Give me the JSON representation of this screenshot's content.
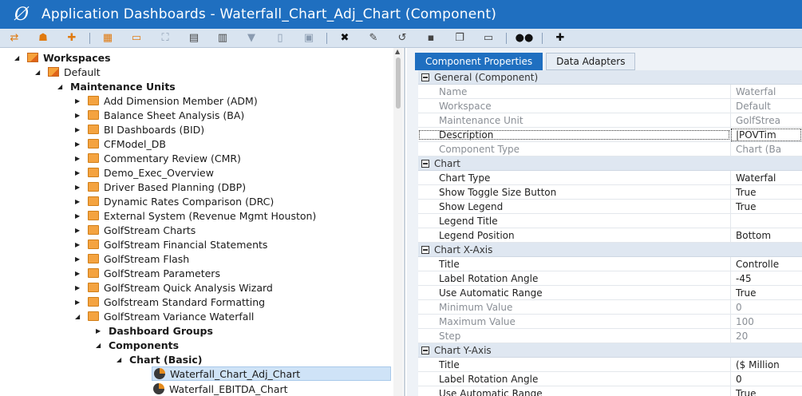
{
  "window": {
    "title": "Application Dashboards - Waterfall_Chart_Adj_Chart (Component)",
    "logo_icon": "onestream-logo"
  },
  "toolbar": {
    "icons": [
      "swap-icon",
      "group-icon",
      "add-user-icon",
      "dashboard-icon",
      "calendar-icon",
      "chart-icon",
      "table-icon",
      "grid-icon",
      "filter-icon",
      "document-icon",
      "textbox-icon",
      "delete-icon",
      "edit-icon",
      "undo-icon",
      "save-icon",
      "copy-icon",
      "paste-icon",
      "search-binoculars-icon",
      "add-icon"
    ]
  },
  "tree": {
    "items": [
      {
        "label": "Workspaces",
        "bold": true
      },
      {
        "label": "Default",
        "bold": false
      },
      {
        "label": "Maintenance Units",
        "bold": true
      },
      {
        "label": "Add Dimension Member (ADM)"
      },
      {
        "label": "Balance Sheet Analysis (BA)"
      },
      {
        "label": "BI Dashboards (BID)"
      },
      {
        "label": "CFModel_DB"
      },
      {
        "label": "Commentary Review (CMR)"
      },
      {
        "label": "Demo_Exec_Overview"
      },
      {
        "label": "Driver Based Planning (DBP)"
      },
      {
        "label": "Dynamic Rates Comparison (DRC)"
      },
      {
        "label": "External System (Revenue Mgmt Houston)"
      },
      {
        "label": "GolfStream Charts"
      },
      {
        "label": "GolfStream Financial Statements"
      },
      {
        "label": "GolfStream Flash"
      },
      {
        "label": "GolfStream Parameters"
      },
      {
        "label": "GolfStream Quick Analysis Wizard"
      },
      {
        "label": "Golfstream Standard Formatting"
      },
      {
        "label": "GolfStream Variance Waterfall"
      },
      {
        "label": "Dashboard Groups",
        "bold": true
      },
      {
        "label": "Components",
        "bold": true
      },
      {
        "label": "Chart (Basic)",
        "bold": true
      },
      {
        "label": "Waterfall_Chart_Adj_Chart"
      },
      {
        "label": "Waterfall_EBITDA_Chart"
      }
    ]
  },
  "tabs": [
    {
      "label": "Component Properties",
      "active": true
    },
    {
      "label": "Data Adapters",
      "active": false
    }
  ],
  "properties": {
    "general": {
      "header": "General (Component)",
      "rows": [
        {
          "key": "Name",
          "value": "Waterfal"
        },
        {
          "key": "Workspace",
          "value": "Default"
        },
        {
          "key": "Maintenance Unit",
          "value": "GolfStrea"
        },
        {
          "key": "Description",
          "value": "|POVTim"
        },
        {
          "key": "Component Type",
          "value": "Chart (Ba"
        }
      ]
    },
    "chart": {
      "header": "Chart",
      "rows": [
        {
          "key": "Chart Type",
          "value": "Waterfal"
        },
        {
          "key": "Show Toggle Size Button",
          "value": "True"
        },
        {
          "key": "Show Legend",
          "value": "True"
        },
        {
          "key": "Legend Title",
          "value": ""
        },
        {
          "key": "Legend Position",
          "value": "Bottom"
        }
      ]
    },
    "xaxis": {
      "header": "Chart X-Axis",
      "rows": [
        {
          "key": "Title",
          "value": "Controlle"
        },
        {
          "key": "Label Rotation Angle",
          "value": "-45"
        },
        {
          "key": "Use Automatic Range",
          "value": "True"
        },
        {
          "key": "Minimum Value",
          "value": "0"
        },
        {
          "key": "Maximum Value",
          "value": "100"
        },
        {
          "key": "Step",
          "value": "20"
        }
      ]
    },
    "yaxis": {
      "header": "Chart Y-Axis",
      "rows": [
        {
          "key": "Title",
          "value": "($ Million"
        },
        {
          "key": "Label Rotation Angle",
          "value": "0"
        },
        {
          "key": "Use Automatic Range",
          "value": "True"
        }
      ]
    }
  }
}
